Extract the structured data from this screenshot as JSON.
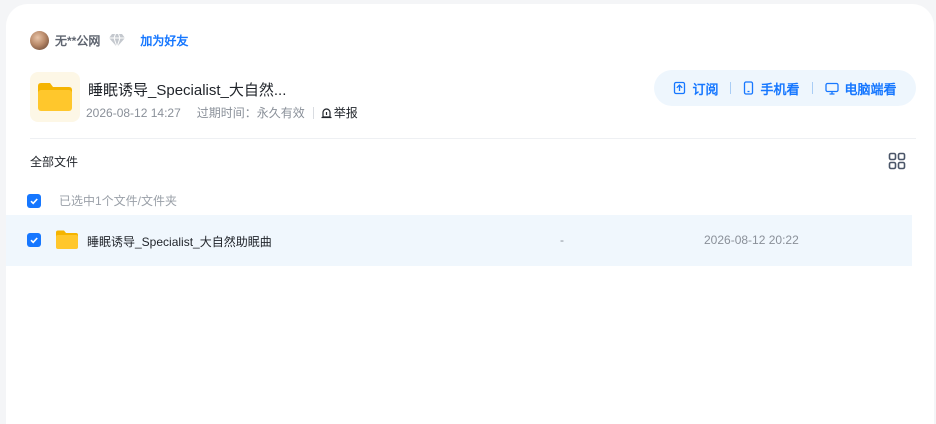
{
  "user": {
    "name": "无**公网",
    "add_friend": "加为好友"
  },
  "share": {
    "title": "睡眠诱导_Specialist_大自然...",
    "created": "2026-08-12 14:27",
    "expiry_label": "过期时间：",
    "expiry_value": "永久有效",
    "report": "举报"
  },
  "actions": {
    "subscribe": "订阅",
    "mobile": "手机看",
    "desktop": "电脑端看"
  },
  "breadcrumb": "全部文件",
  "selection": {
    "text": "已选中1个文件/文件夹"
  },
  "files": [
    {
      "name": "睡眠诱导_Specialist_大自然助眠曲",
      "size": "-",
      "date": "2026-08-12 20:22"
    }
  ],
  "colors": {
    "accent": "#1677ff",
    "row_highlight": "#f0f7fd",
    "folder": "#ffc72c"
  },
  "icons": {
    "vip": "diamond-icon",
    "report": "report-icon",
    "subscribe": "subscribe-icon",
    "mobile": "phone-icon",
    "desktop": "monitor-icon",
    "view_toggle": "grid-view-icon",
    "folder": "folder-icon"
  }
}
